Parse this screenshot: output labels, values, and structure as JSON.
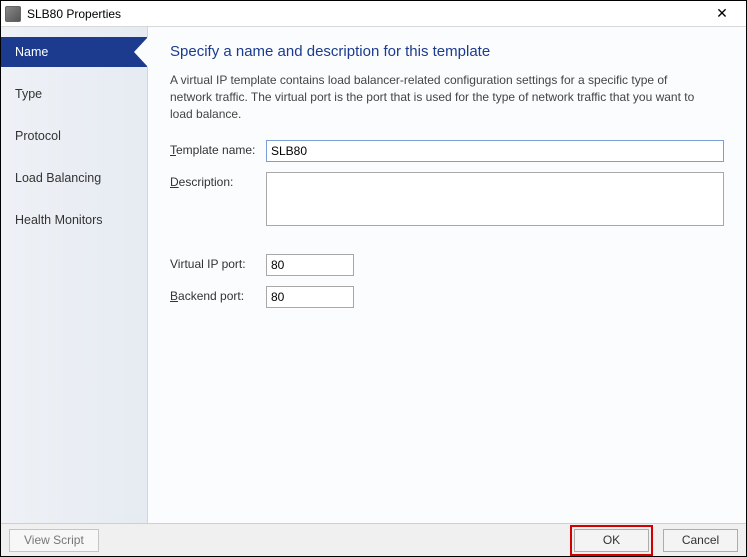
{
  "window": {
    "title": "SLB80 Properties"
  },
  "sidebar": {
    "items": [
      {
        "label": "Name",
        "active": true
      },
      {
        "label": "Type"
      },
      {
        "label": "Protocol"
      },
      {
        "label": "Load Balancing"
      },
      {
        "label": "Health Monitors"
      }
    ]
  },
  "page": {
    "heading": "Specify a name and description for this template",
    "intro": "A virtual IP template contains load balancer-related configuration settings for a specific type of network traffic. The virtual port is the port that is used for the type of network traffic that you want to load balance."
  },
  "form": {
    "template_name_label": "Template name:",
    "template_name_value": "SLB80",
    "description_label": "Description:",
    "description_value": "",
    "virtual_ip_port_label": "Virtual IP port:",
    "virtual_ip_port_value": "80",
    "backend_port_label": "Backend port:",
    "backend_port_value": "80"
  },
  "buttons": {
    "view_script": "View Script",
    "ok": "OK",
    "cancel": "Cancel"
  }
}
